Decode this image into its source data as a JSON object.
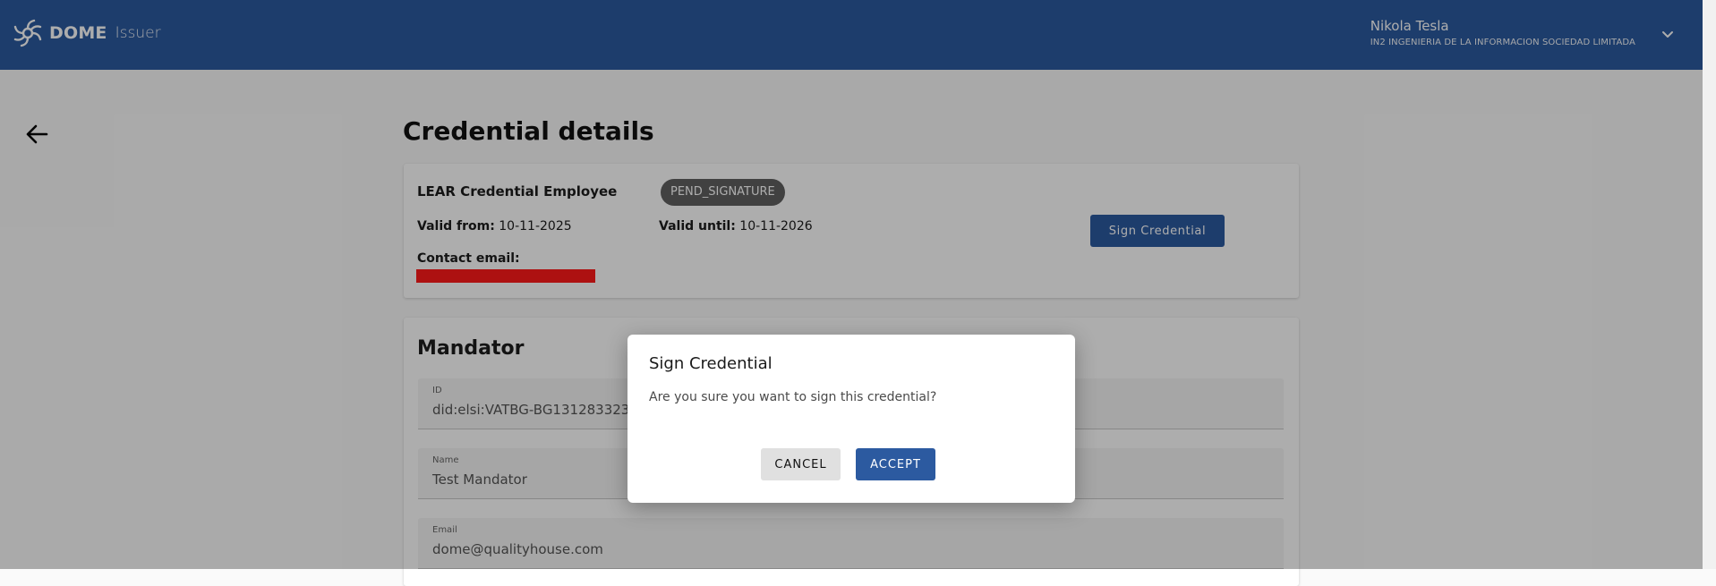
{
  "header": {
    "brand": "DOME",
    "brand_sub": "Issuer",
    "user_name": "Nikola Tesla",
    "user_org": "IN2 INGENIERIA DE LA INFORMACION SOCIEDAD LIMITADA",
    "icons": {
      "logo": "dome-logo-icon",
      "menu": "chevron-down-icon"
    }
  },
  "navigation": {
    "back_icon": "arrow-left-icon"
  },
  "page": {
    "title": "Credential details"
  },
  "summary": {
    "credential_type": "LEAR Credential Employee",
    "status": "PEND_SIGNATURE",
    "valid_from_label": "Valid from:",
    "valid_from": "10-11-2025",
    "valid_until_label": "Valid until:",
    "valid_until": "10-11-2026",
    "contact_email_label": "Contact email:",
    "sign_button": "Sign Credential"
  },
  "mandator": {
    "title": "Mandator",
    "fields": [
      {
        "label": "ID",
        "value": "did:elsi:VATBG-BG131283323"
      },
      {
        "label": "Name",
        "value": "Test Mandator"
      },
      {
        "label": "Email",
        "value": "dome@qualityhouse.com"
      }
    ]
  },
  "dialog": {
    "title": "Sign Credential",
    "message": "Are you sure you want to sign this credential?",
    "cancel": "CANCEL",
    "accept": "ACCEPT"
  },
  "colors": {
    "primary": "#2c5aa0",
    "badge": "#616161",
    "redaction": "#ff1a1a",
    "overlay": "rgba(0,0,0,0.32)"
  }
}
